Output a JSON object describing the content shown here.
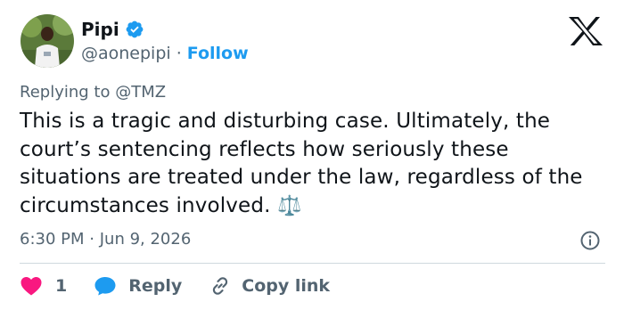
{
  "colors": {
    "accent": "#1d9bf0",
    "text_primary": "#0f1419",
    "text_secondary": "#536471",
    "like": "#f91880",
    "divider": "#cfd9de"
  },
  "author": {
    "name": "Pipi",
    "handle": "@aonepipi",
    "separator": "·",
    "follow_label": "Follow",
    "verified_icon": "verified-badge-icon"
  },
  "platform_icon": "x-logo-icon",
  "reply_context": {
    "prefix": "Replying to",
    "mention": "@TMZ"
  },
  "tweet": {
    "text": "This is a tragic and disturbing case. Ultimately, the court’s sentencing reflects how seriously these situations are treated under the law, regardless of the circumstances involved.",
    "emoji": "⚖️",
    "time": "6:30 PM",
    "separator": "·",
    "date": "Jun 9, 2026"
  },
  "actions": {
    "like_count": "1",
    "reply_label": "Reply",
    "copy_link_label": "Copy link"
  }
}
